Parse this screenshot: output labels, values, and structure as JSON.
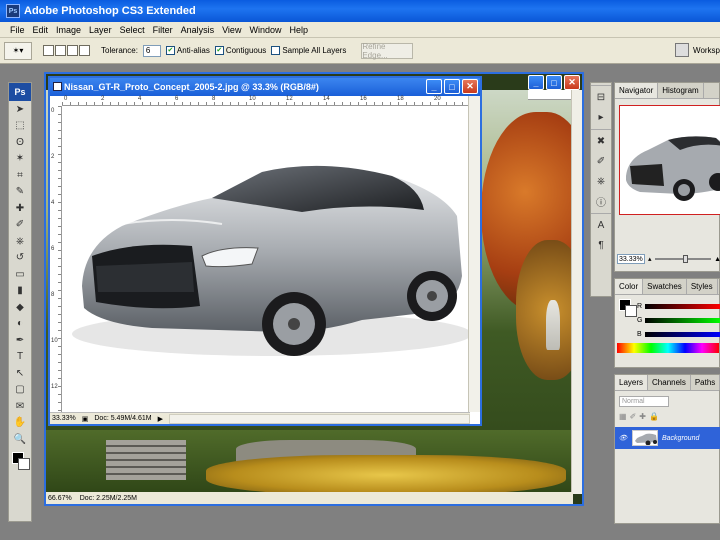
{
  "app": {
    "title": "Adobe Photoshop CS3 Extended",
    "logo_text": "Ps",
    "accent": "#0a5ce0"
  },
  "menu": [
    "File",
    "Edit",
    "Image",
    "Layer",
    "Select",
    "Filter",
    "Analysis",
    "View",
    "Window",
    "Help"
  ],
  "options": {
    "tolerance_label": "Tolerance:",
    "tolerance_value": "6",
    "anti_alias": "Anti-alias",
    "contiguous": "Contiguous",
    "sample_all_layers": "Sample All Layers",
    "refine_edge": "Refine Edge...",
    "workspace": "Worksp"
  },
  "toolbox": {
    "tab": "Ps",
    "tools": [
      "move-icon",
      "marquee-icon",
      "lasso-icon",
      "magic-wand-icon",
      "crop-icon",
      "eyedropper-icon",
      "healing-brush-icon",
      "brush-icon",
      "clone-stamp-icon",
      "history-brush-icon",
      "eraser-icon",
      "gradient-icon",
      "blur-icon",
      "dodge-icon",
      "pen-icon",
      "type-icon",
      "path-selection-icon",
      "rectangle-icon",
      "notes-icon",
      "zoom-hand-icon",
      "zoom-icon"
    ],
    "glyphs": [
      "➤",
      "⬚",
      "ʘ",
      "✶",
      "⌗",
      "✎",
      "✚",
      "✐",
      "⎈",
      "↺",
      "▭",
      "▮",
      "◆",
      "◐",
      "✒",
      "T",
      "↖",
      "▢",
      "✉",
      "✋",
      "🔍"
    ]
  },
  "doc_back": {
    "zoom": "66.67%",
    "doc_size": "Doc: 2.25M/2.25M"
  },
  "doc_front": {
    "title": "Nissan_GT-R_Proto_Concept_2005-2.jpg @ 33.3% (RGB/8#)",
    "zoom": "33.33%",
    "doc_size": "Doc: 5.49M/4.61M",
    "ruler_h": [
      "0",
      "2",
      "4",
      "6",
      "8",
      "10",
      "12",
      "14",
      "16",
      "18",
      "20"
    ],
    "ruler_v": [
      "0",
      "2",
      "4",
      "6",
      "8",
      "10",
      "12"
    ]
  },
  "navigator": {
    "tabs": [
      "Navigator",
      "Histogram"
    ],
    "zoom": "33.33%"
  },
  "color_panel": {
    "tabs": [
      "Color",
      "Swatches",
      "Styles"
    ],
    "channels": [
      "R",
      "G",
      "B"
    ]
  },
  "layers_panel": {
    "tabs": [
      "Layers",
      "Channels",
      "Paths"
    ],
    "blend_mode": "Normal",
    "layer_name": "Background"
  }
}
